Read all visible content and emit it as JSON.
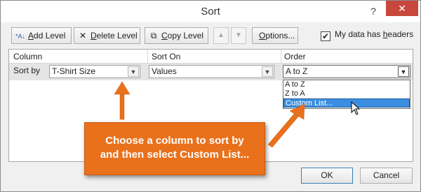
{
  "dialog": {
    "title": "Sort",
    "help_label": "?",
    "close_label": "✕"
  },
  "toolbar": {
    "add_level_pre": "",
    "add_level_u": "A",
    "add_level_post": "dd Level",
    "delete_level_u": "D",
    "delete_level_post": "elete Level",
    "copy_level_u": "C",
    "copy_level_post": "opy Level",
    "move_up_label": "▲",
    "move_down_label": "▼",
    "options_u": "O",
    "options_post": "ptions...",
    "headers_checkbox_pre": "My data has ",
    "headers_checkbox_u": "h",
    "headers_checkbox_post": "eaders",
    "headers_checked": "✔",
    "add_icon": "*A↓",
    "delete_icon": "✕",
    "copy_icon": "⧉"
  },
  "grid": {
    "col_column": "Column",
    "col_sort_on": "Sort On",
    "col_order": "Order",
    "row_label": "Sort by",
    "column_value": "T-Shirt Size",
    "sort_on_value": "Values",
    "order_value": "A to Z"
  },
  "order_options": [
    "A to Z",
    "Z to A",
    "Custom List..."
  ],
  "selected_option_index": 2,
  "callout": {
    "line1": "Choose a column to sort by",
    "line2": "and then select Custom List..."
  },
  "buttons": {
    "ok": "OK",
    "cancel": "Cancel"
  },
  "colors": {
    "callout": "#e9711c",
    "selection": "#3b8ee0",
    "close": "#c7473c"
  }
}
